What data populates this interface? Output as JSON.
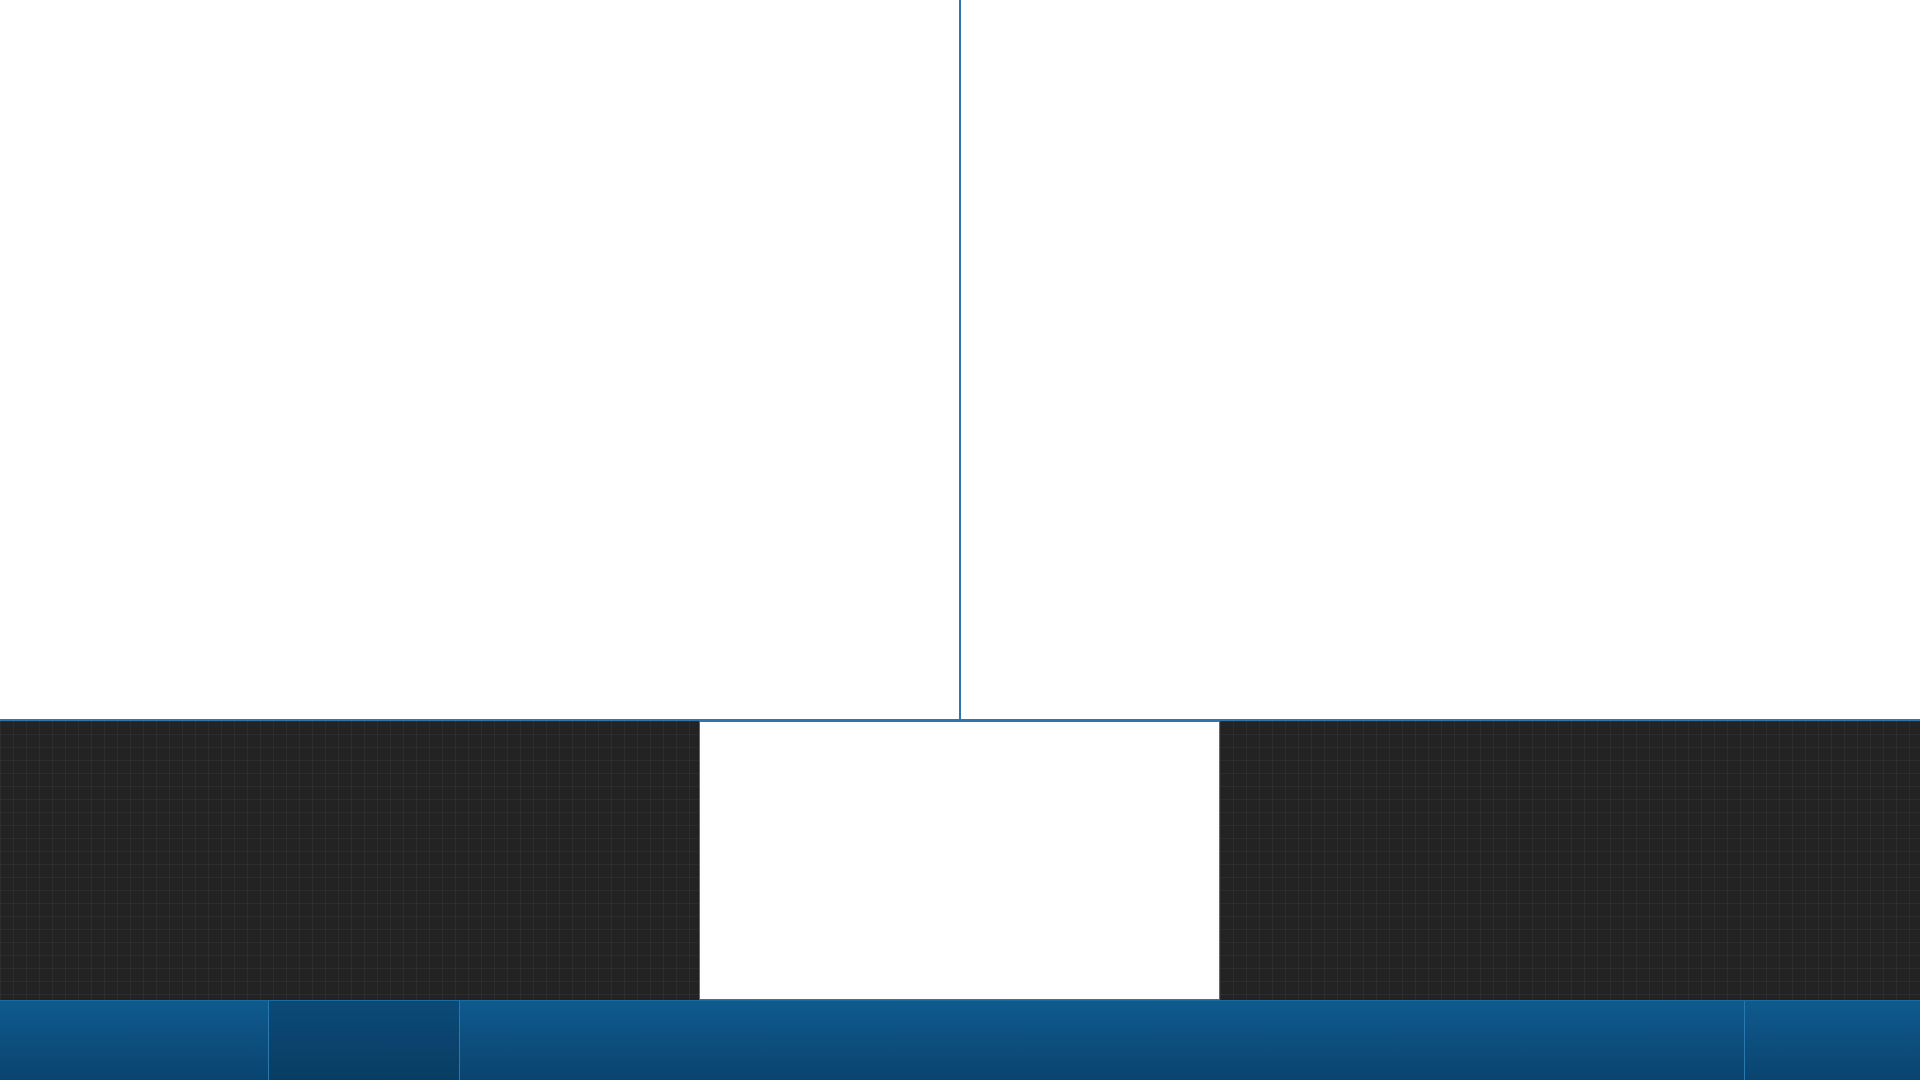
{
  "colors": {
    "divider": "#2b77ad",
    "pane_background": "#ffffff",
    "dark_panel": "#232323",
    "taskbar_top": "#0f5a8e",
    "taskbar_bottom": "#0a4470",
    "taskbar_active": "#0b4a78"
  },
  "taskbar": {
    "segments": [
      "",
      "",
      "",
      ""
    ]
  }
}
